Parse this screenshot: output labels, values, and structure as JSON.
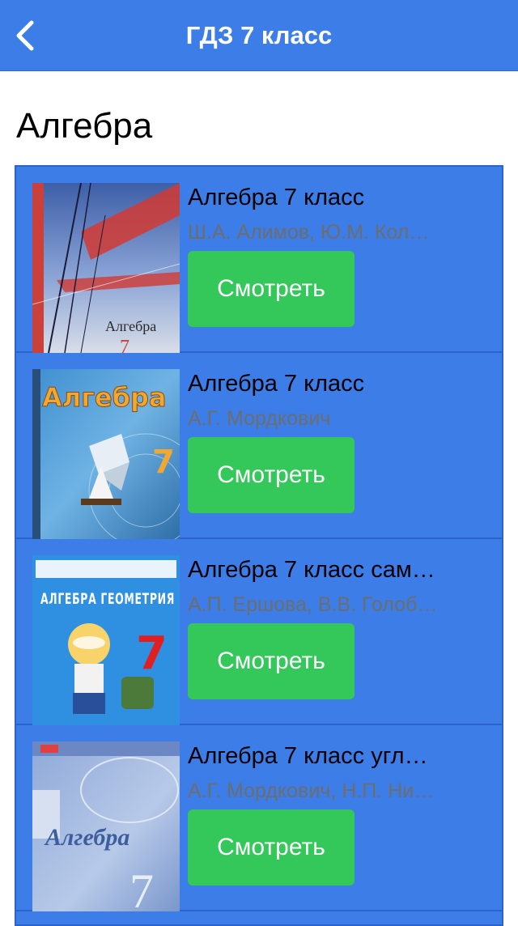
{
  "header": {
    "title": "ГДЗ 7 класс",
    "back_icon": "chevron-left-icon"
  },
  "section": {
    "title": "Алгебра"
  },
  "books": [
    {
      "title": "Алгебра 7 класс",
      "authors": "Ш.А. Алимов, Ю.М. Кол…",
      "button_label": "Смотреть",
      "cover_text": "Алгебра",
      "cover_number": "7"
    },
    {
      "title": "Алгебра 7 класс",
      "authors": "А.Г. Мордкович",
      "button_label": "Смотреть",
      "cover_text": "Алгебра",
      "cover_number": "7"
    },
    {
      "title": "Алгебра 7 класс сам…",
      "authors": "А.П. Ершова, В.В. Голоб…",
      "button_label": "Смотреть",
      "cover_text": "АЛГЕБРА ГЕОМЕТРИЯ",
      "cover_number": "7"
    },
    {
      "title": "Алгебра 7 класс угл…",
      "authors": "А.Г. Мордкович, Н.П. Ни…",
      "button_label": "Смотреть",
      "cover_text": "Алгебра",
      "cover_number": "7"
    }
  ],
  "colors": {
    "header_bg": "#3d7de8",
    "list_bg": "#3d7de8",
    "button_bg": "#34c759",
    "author_text": "#6d6d6d"
  }
}
